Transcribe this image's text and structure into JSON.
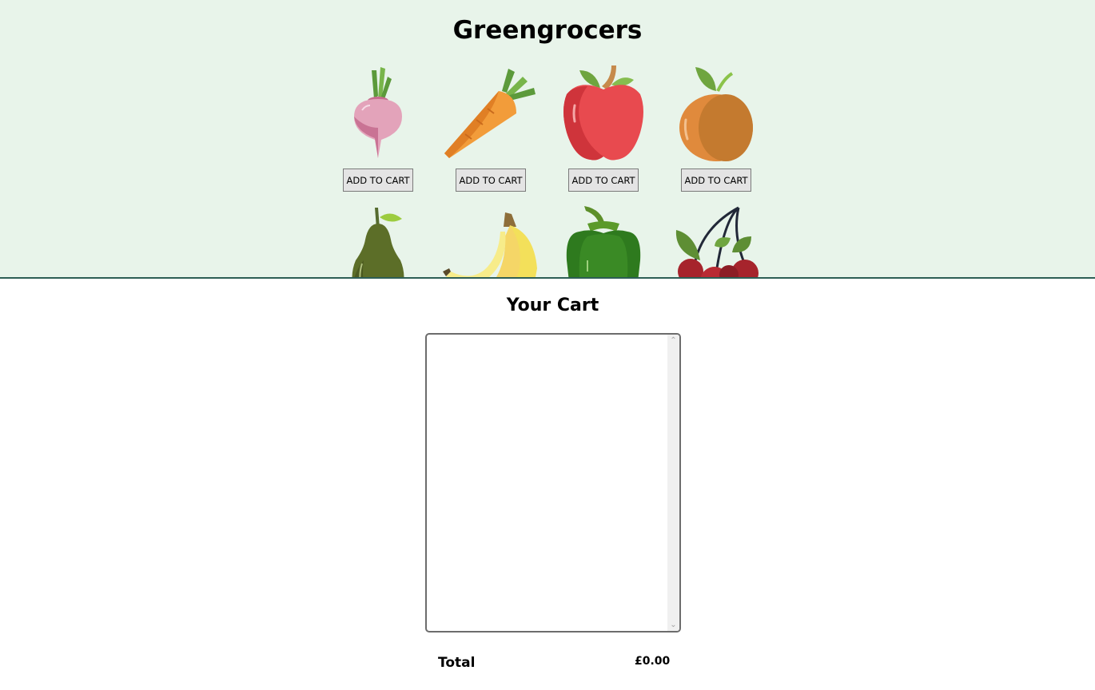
{
  "store": {
    "title": "Greengrocers",
    "items": [
      {
        "icon": "beetroot-icon",
        "button_label": "ADD TO CART"
      },
      {
        "icon": "carrot-icon",
        "button_label": "ADD TO CART"
      },
      {
        "icon": "apple-icon",
        "button_label": "ADD TO CART"
      },
      {
        "icon": "apricot-icon",
        "button_label": "ADD TO CART"
      },
      {
        "icon": "avocado-icon"
      },
      {
        "icon": "bananas-icon"
      },
      {
        "icon": "bell-pepper-icon"
      },
      {
        "icon": "berry-icon"
      }
    ]
  },
  "cart": {
    "title": "Your Cart",
    "total_label": "Total",
    "total_value": "£0.00"
  },
  "colors": {
    "header_bg": "#e8f4ea",
    "header_border": "#2d5e55"
  }
}
